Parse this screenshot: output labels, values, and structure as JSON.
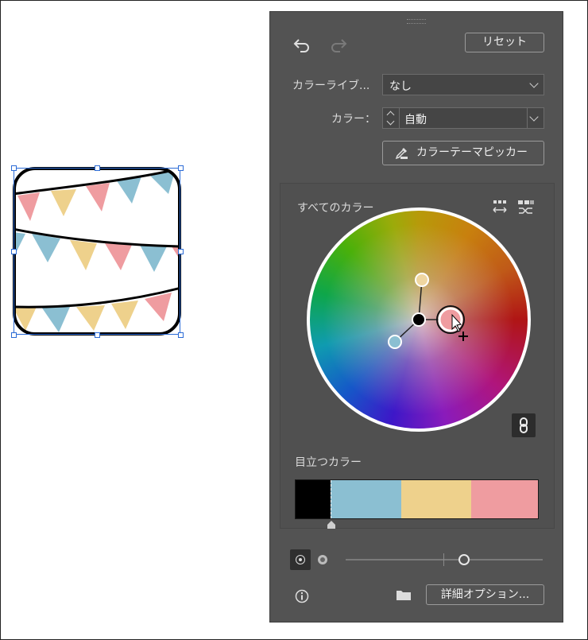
{
  "panel": {
    "reset_label": "リセット",
    "library_label": "カラーライブ...",
    "library_value": "なし",
    "color_label": "カラー：",
    "color_value": "自動",
    "theme_picker_label": "カラーテーマピッカー",
    "all_colors_label": "すべてのカラー",
    "prominent_label": "目立つカラー",
    "advanced_options_label": "詳細オプション..."
  },
  "prominent_colors": [
    "#000000",
    "#8bbfd2",
    "#eed18c",
    "#ef9ca0"
  ],
  "prominent_ratios": [
    0.15,
    0.29,
    0.29,
    0.27
  ],
  "wheel_handles": [
    {
      "name": "yellow",
      "color": "#efd6a0"
    },
    {
      "name": "pink",
      "color": "#ef9ca0"
    },
    {
      "name": "blue",
      "color": "#8bbfd2"
    },
    {
      "name": "center",
      "color": "#000000"
    }
  ],
  "saturation_slider": 0.6,
  "icons": {
    "undo": "undo-icon",
    "redo": "redo-icon",
    "eyedropper": "eyedropper-icon",
    "spread": "spread-harmony-icon",
    "shuffle": "shuffle-icon",
    "link": "link-icon",
    "info": "info-icon",
    "folder": "folder-icon"
  }
}
